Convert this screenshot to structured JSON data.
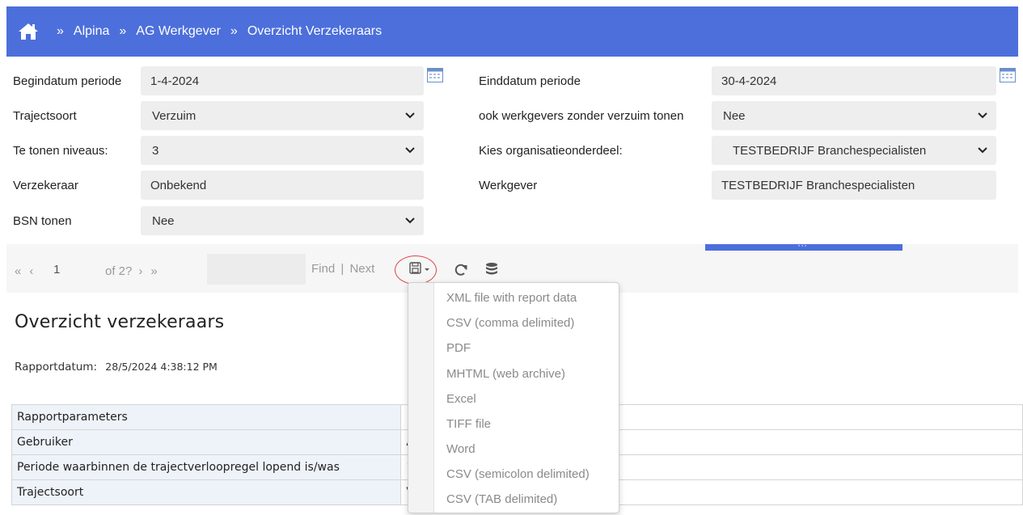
{
  "breadcrumb": {
    "home_icon": "home-icon",
    "separator": "»",
    "items": [
      "Alpina",
      "AG Werkgever",
      "Overzicht Verzekeraars"
    ]
  },
  "form": {
    "begindatum": {
      "label": "Begindatum periode",
      "value": "1-4-2024"
    },
    "einddatum": {
      "label": "Einddatum periode",
      "value": "30-4-2024"
    },
    "trajectsoort": {
      "label": "Trajectsoort",
      "value": "Verzuim"
    },
    "zonder_verzuim": {
      "label": "ook werkgevers zonder verzuim tonen",
      "value": "Nee"
    },
    "niveaus": {
      "label": "Te tonen niveaus:",
      "value": "3"
    },
    "organisatie": {
      "label": "Kies organisatieonderdeel:",
      "value": "TESTBEDRIJF Branchespecialisten"
    },
    "verzekeraar": {
      "label": "Verzekeraar",
      "value": "Onbekend"
    },
    "werkgever": {
      "label": "Werkgever",
      "value": "TESTBEDRIJF Branchespecialisten"
    },
    "bsn": {
      "label": "BSN tonen",
      "value": "Nee"
    }
  },
  "toolbar": {
    "first": "«",
    "prev": "‹",
    "page": "1",
    "of_pages": "of 2?",
    "next": "›",
    "last": "»",
    "find": "Find",
    "divider": "|",
    "next_label": "Next",
    "collapse": "···"
  },
  "export_menu": {
    "items": [
      "XML file with report data",
      "CSV (comma delimited)",
      "PDF",
      "MHTML (web archive)",
      "Excel",
      "TIFF file",
      "Word",
      "CSV (semicolon delimited)",
      "CSV (TAB delimited)"
    ]
  },
  "report": {
    "title": "Overzicht verzekeraars",
    "date_label": "Rapportdatum:",
    "date_value": "28/5/2024 4:38:12 PM",
    "rows": [
      {
        "key": "Rapportparameters",
        "value": ""
      },
      {
        "key": "Gebruiker",
        "value": "A"
      },
      {
        "key": "Periode waarbinnen de trajectverloopregel lopend is/was",
        "value": "1"
      },
      {
        "key": "Trajectsoort",
        "value": "V"
      }
    ]
  },
  "colors": {
    "header_bg": "#4c6fdc",
    "field_bg": "#eeeeee",
    "highlight_circle": "#dd4444"
  }
}
